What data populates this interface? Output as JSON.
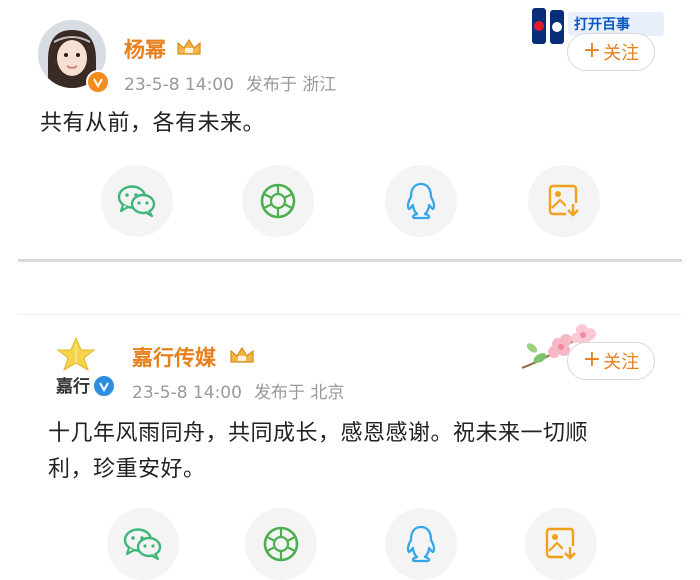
{
  "posts": [
    {
      "author": "杨幂",
      "date": "23-5-8 14:00",
      "location": "发布于 浙江",
      "content": "共有从前，各有未来。",
      "follow_label": "关注",
      "ad_text": "打开百事"
    },
    {
      "author": "嘉行传媒",
      "logo_text": "嘉行",
      "date": "23-5-8 14:00",
      "location": "发布于 北京",
      "content_line1": "十几年风雨同舟，共同成长，感恩感谢。祝未来一切顺",
      "content_line2": "利，珍重安好。",
      "follow_label": "关注"
    }
  ],
  "share_icons": [
    "wechat-icon",
    "moments-icon",
    "qq-icon",
    "save-image-icon"
  ],
  "colors": {
    "name": "#e7801d",
    "meta": "#999999",
    "wechat": "#3fb57a",
    "moments": "#4caf50",
    "qq": "#34a7e8",
    "save": "#f0a01a"
  }
}
